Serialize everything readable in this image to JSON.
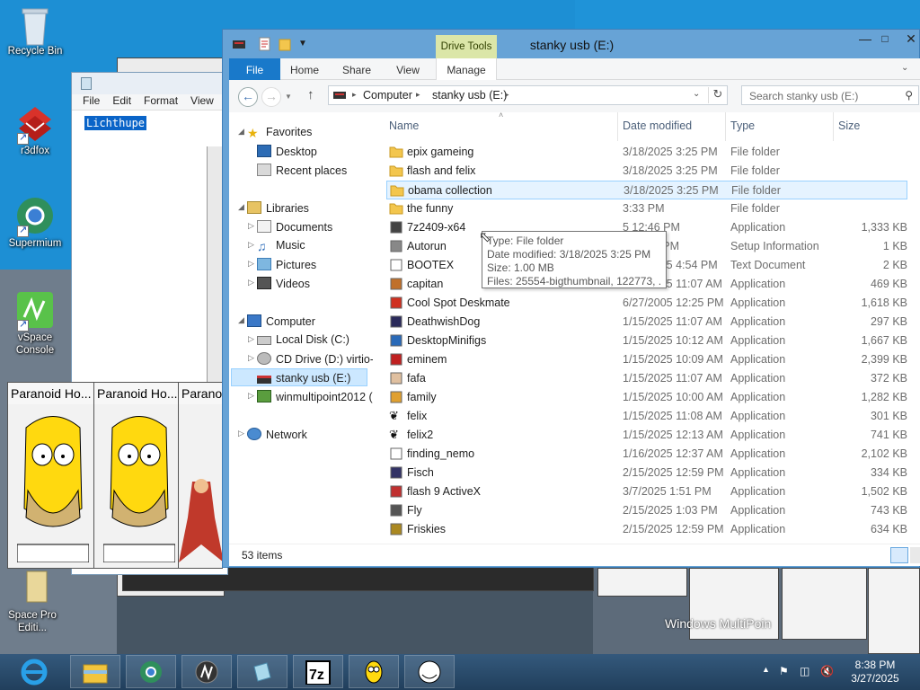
{
  "desktop": {
    "icons": [
      {
        "label": "Recycle Bin",
        "icon": "recycle-bin-icon"
      },
      {
        "label": "r3dfox",
        "icon": "r3dfox-icon"
      },
      {
        "label": "Supermium",
        "icon": "supermium-icon"
      },
      {
        "label": "vSpace Console",
        "icon": "vspace-console-icon"
      },
      {
        "label": "Space Pro Editi...",
        "icon": "space-pro-editor-icon"
      }
    ],
    "watermark": "Windows MultiPoin"
  },
  "notepad": {
    "menu": [
      "File",
      "Edit",
      "Format",
      "View"
    ],
    "selected_text": "Lichthupe"
  },
  "homer_windows": {
    "title": "Paranoid Ho...",
    "title3": "Parano"
  },
  "explorer": {
    "title": "stanky usb (E:)",
    "context_tab_group": "Drive Tools",
    "ribbon_tabs": [
      "File",
      "Home",
      "Share",
      "View",
      "Manage"
    ],
    "address": {
      "crumb1": "Computer",
      "crumb2": "stanky usb (E:)"
    },
    "search_placeholder": "Search stanky usb (E:)",
    "nav": {
      "favorites": "Favorites",
      "desktop": "Desktop",
      "recent": "Recent places",
      "libraries": "Libraries",
      "documents": "Documents",
      "music": "Music",
      "pictures": "Pictures",
      "videos": "Videos",
      "computer": "Computer",
      "local_disk": "Local Disk (C:)",
      "cd_drive": "CD Drive (D:) virtio-w",
      "stanky": "stanky usb (E:)",
      "winmp": "winmultipoint2012 (",
      "network": "Network"
    },
    "columns": {
      "name": "Name",
      "date": "Date modified",
      "type": "Type",
      "size": "Size"
    },
    "files": [
      {
        "name": "epix gameing",
        "date": "3/18/2025 3:25 PM",
        "type": "File folder",
        "size": "",
        "icon": "folder-icon"
      },
      {
        "name": "flash and felix",
        "date": "3/18/2025 3:25 PM",
        "type": "File folder",
        "size": "",
        "icon": "folder-icon"
      },
      {
        "name": "obama collection",
        "date": "3/18/2025 3:25 PM",
        "type": "File folder",
        "size": "",
        "icon": "folder-icon"
      },
      {
        "name": "the funny",
        "date": "3:33 PM",
        "type": "File folder",
        "size": "",
        "icon": "folder-icon"
      },
      {
        "name": "7z2409-x64",
        "date": "5 12:46 PM",
        "type": "Application",
        "size": "1,333 KB",
        "icon": "7zip-icon"
      },
      {
        "name": "Autorun",
        "date": "5 11:05 PM",
        "type": "Setup Information",
        "size": "1 KB",
        "icon": "autorun-icon"
      },
      {
        "name": "BOOTEX",
        "date": "3/18/2025 4:54 PM",
        "type": "Text Document",
        "size": "2 KB",
        "icon": "text-file-icon"
      },
      {
        "name": "capitan",
        "date": "1/15/2025 11:07 AM",
        "type": "Application",
        "size": "469 KB",
        "icon": "capitan-icon"
      },
      {
        "name": "Cool Spot Deskmate",
        "date": "6/27/2005 12:25 PM",
        "type": "Application",
        "size": "1,618 KB",
        "icon": "cool-spot-icon"
      },
      {
        "name": "DeathwishDog",
        "date": "1/15/2025 11:07 AM",
        "type": "Application",
        "size": "297 KB",
        "icon": "deathwishdog-icon"
      },
      {
        "name": "DesktopMinifigs",
        "date": "1/15/2025 10:12 AM",
        "type": "Application",
        "size": "1,667 KB",
        "icon": "minifigs-icon"
      },
      {
        "name": "eminem",
        "date": "1/15/2025 10:09 AM",
        "type": "Application",
        "size": "2,399 KB",
        "icon": "eminem-icon"
      },
      {
        "name": "fafa",
        "date": "1/15/2025 11:07 AM",
        "type": "Application",
        "size": "372 KB",
        "icon": "fafa-icon"
      },
      {
        "name": "family",
        "date": "1/15/2025 10:00 AM",
        "type": "Application",
        "size": "1,282 KB",
        "icon": "family-icon"
      },
      {
        "name": "felix",
        "date": "1/15/2025 11:08 AM",
        "type": "Application",
        "size": "301 KB",
        "icon": "paw-icon"
      },
      {
        "name": "felix2",
        "date": "1/15/2025 12:13 AM",
        "type": "Application",
        "size": "741 KB",
        "icon": "paw-icon"
      },
      {
        "name": "finding_nemo",
        "date": "1/16/2025 12:37 AM",
        "type": "Application",
        "size": "2,102 KB",
        "icon": "blank-app-icon"
      },
      {
        "name": "Fisch",
        "date": "2/15/2025 12:59 PM",
        "type": "Application",
        "size": "334 KB",
        "icon": "fisch-icon"
      },
      {
        "name": "flash 9 ActiveX",
        "date": "3/7/2025 1:51 PM",
        "type": "Application",
        "size": "1,502 KB",
        "icon": "flash-icon"
      },
      {
        "name": "Fly",
        "date": "2/15/2025 1:03 PM",
        "type": "Application",
        "size": "743 KB",
        "icon": "fly-icon"
      },
      {
        "name": "Friskies",
        "date": "2/15/2025 12:59 PM",
        "type": "Application",
        "size": "634 KB",
        "icon": "friskies-icon"
      }
    ],
    "tooltip": {
      "type": "Type: File folder",
      "date": "Date modified: 3/18/2025 3:25 PM",
      "size": "Size: 1.00 MB",
      "files": "Files: 25554-bigthumbnail, 122773, ..."
    },
    "status": "53 items"
  },
  "taskbar": {
    "clock_time": "8:38 PM",
    "clock_date": "3/27/2025",
    "buttons": [
      "internet-explorer-icon",
      "file-explorer-icon",
      "supermium-icon",
      "vspace-icon",
      "glass-icon",
      "7zip-icon",
      "homer-icon",
      "troll-icon"
    ],
    "accent": "#2a4b6b"
  }
}
